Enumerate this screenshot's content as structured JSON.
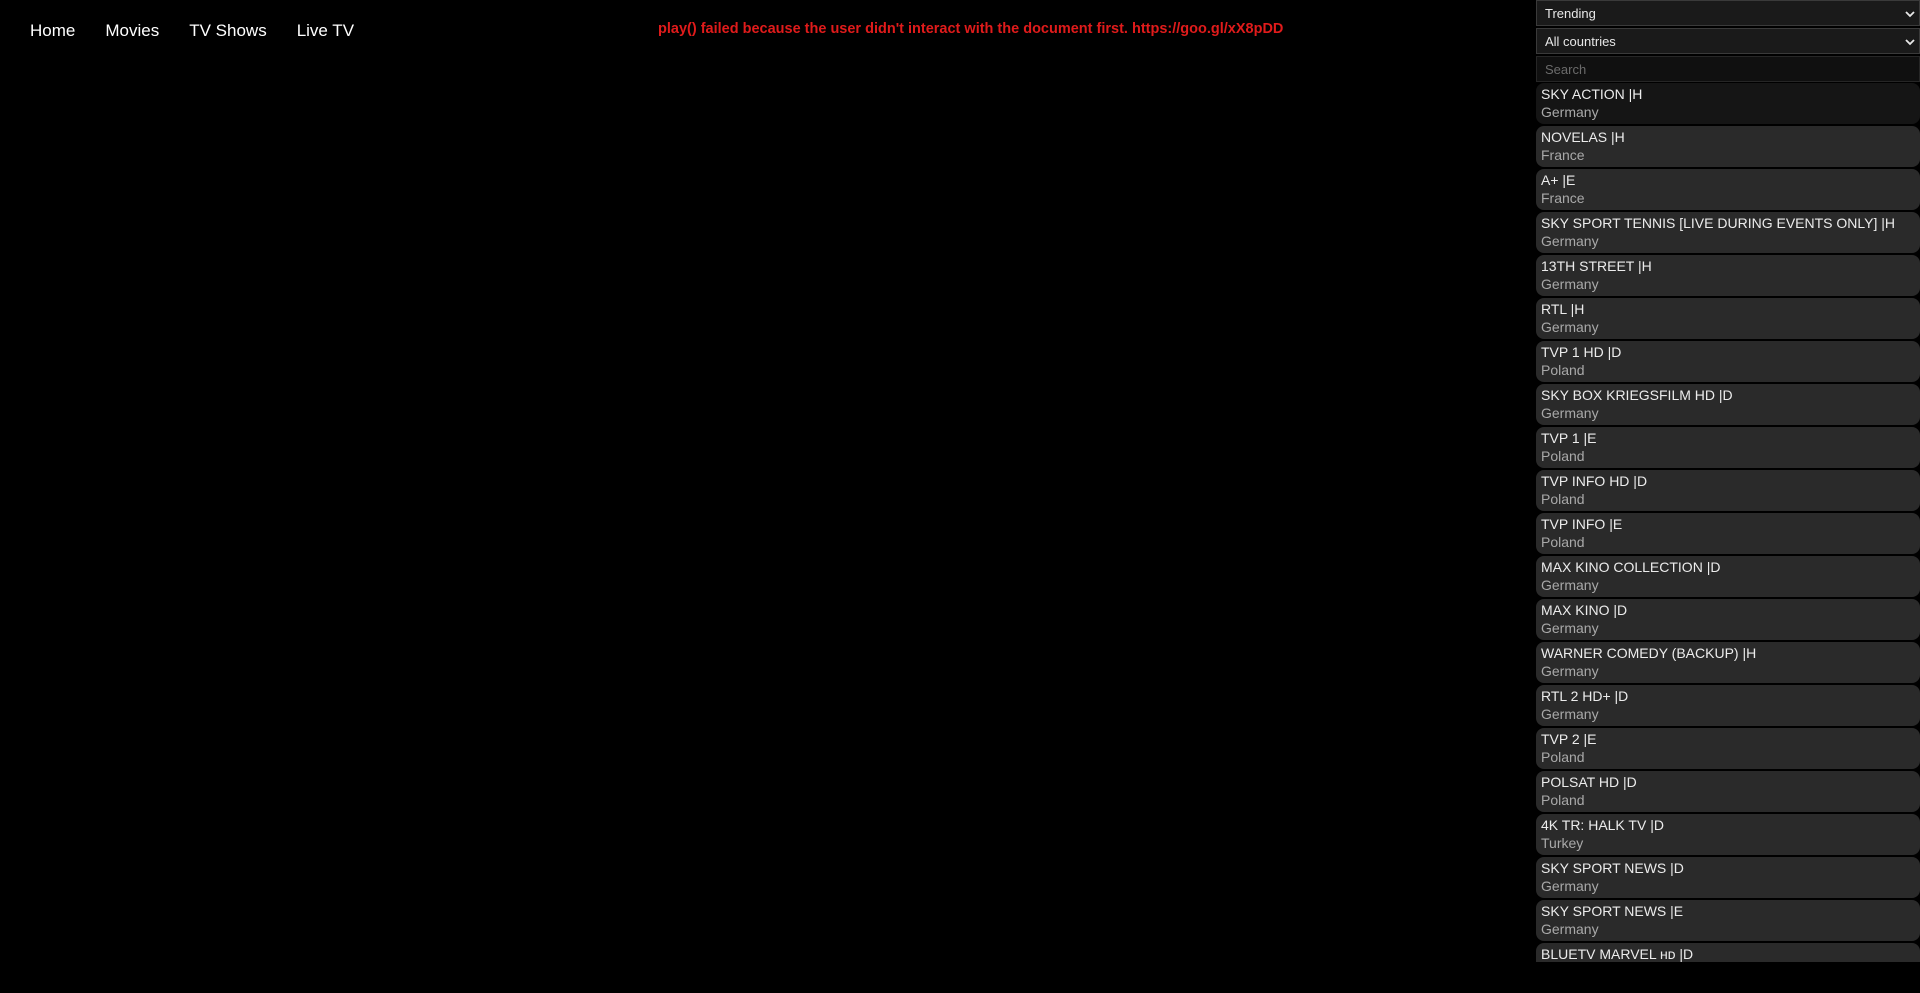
{
  "nav": {
    "items": [
      "Home",
      "Movies",
      "TV Shows",
      "Live TV"
    ]
  },
  "error_message": "play() failed because the user didn't interact with the document first. https://goo.gl/xX8pDD",
  "sidebar": {
    "sort_select": "Trending",
    "country_select": "All countries",
    "search_placeholder": "Search",
    "channels": [
      {
        "name": "SKY ACTION |H",
        "country": "Germany"
      },
      {
        "name": "NOVELAS |H",
        "country": "France"
      },
      {
        "name": "A+ |E",
        "country": "France"
      },
      {
        "name": "SKY SPORT TENNIS [LIVE DURING EVENTS ONLY] |H",
        "country": "Germany"
      },
      {
        "name": "13TH STREET |H",
        "country": "Germany"
      },
      {
        "name": "RTL |H",
        "country": "Germany"
      },
      {
        "name": "TVP 1 HD |D",
        "country": "Poland"
      },
      {
        "name": "SKY BOX KRIEGSFILM HD |D",
        "country": "Germany"
      },
      {
        "name": "TVP 1 |E",
        "country": "Poland"
      },
      {
        "name": "TVP INFO HD |D",
        "country": "Poland"
      },
      {
        "name": "TVP INFO |E",
        "country": "Poland"
      },
      {
        "name": "MAX KINO COLLECTION |D",
        "country": "Germany"
      },
      {
        "name": "MAX KINO |D",
        "country": "Germany"
      },
      {
        "name": "WARNER COMEDY (BACKUP) |H",
        "country": "Germany"
      },
      {
        "name": "RTL 2 HD+ |D",
        "country": "Germany"
      },
      {
        "name": "TVP 2 |E",
        "country": "Poland"
      },
      {
        "name": "POLSAT HD |D",
        "country": "Poland"
      },
      {
        "name": "4K TR: HALK TV |D",
        "country": "Turkey"
      },
      {
        "name": "SKY SPORT NEWS |D",
        "country": "Germany"
      },
      {
        "name": "SKY SPORT NEWS |E",
        "country": "Germany"
      },
      {
        "name": "BLUETV MARVEL ʜᴅ |D",
        "country": ""
      }
    ]
  },
  "icons": {
    "select_chevron": "chevron-down-icon"
  },
  "colors": {
    "background": "#000000",
    "error_text": "#e01b1b",
    "channel_bg": "#2a2a2a",
    "channel_active_bg": "#151515"
  }
}
